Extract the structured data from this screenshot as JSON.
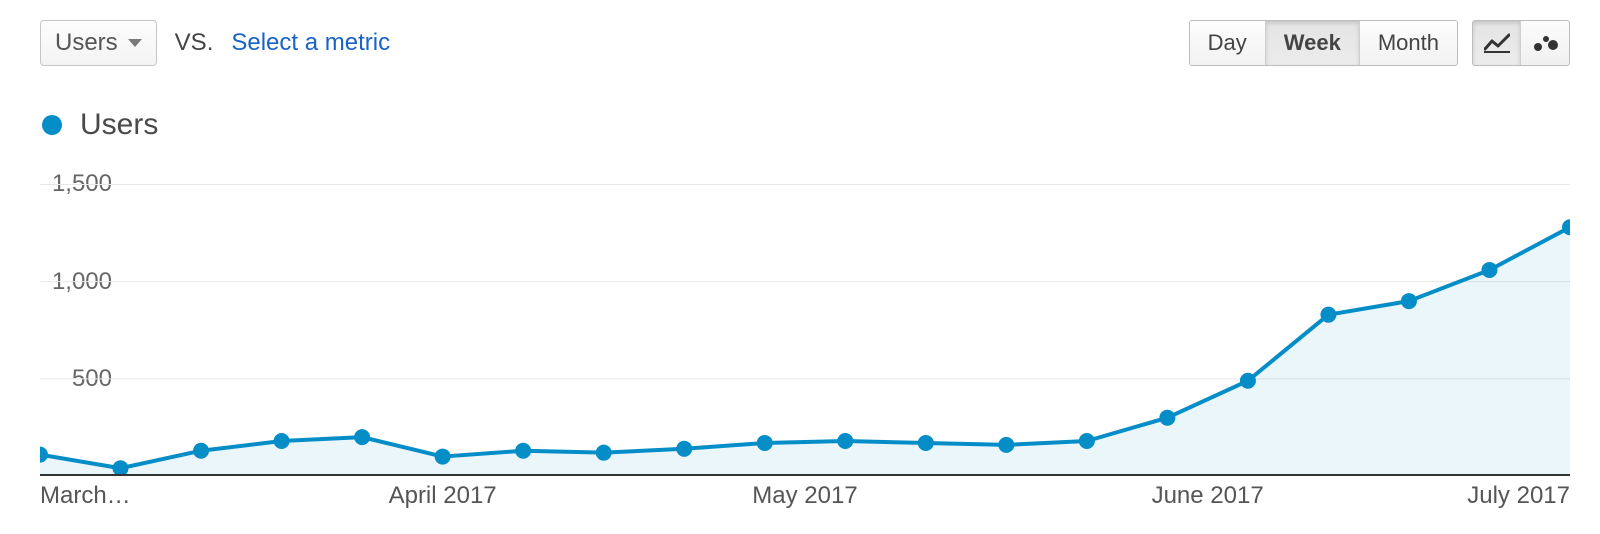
{
  "toolbar": {
    "primary_metric": "Users",
    "vs_label": "VS.",
    "select_metric_label": "Select a metric",
    "granularity": {
      "options": [
        "Day",
        "Week",
        "Month"
      ],
      "active_index": 1
    },
    "chart_type_icons": [
      "line-chart-icon",
      "motion-chart-icon"
    ],
    "chart_type_active_index": 0
  },
  "legend": {
    "series_label": "Users",
    "series_color": "#058dc7"
  },
  "y_ticks": [
    "1,500",
    "1,000",
    "500"
  ],
  "x_major_ticks": [
    "March…",
    "April 2017",
    "May 2017",
    "June 2017",
    "July 2017"
  ],
  "chart_data": {
    "type": "line",
    "title": "",
    "xlabel": "",
    "ylabel": "",
    "ylim": [
      0,
      1600
    ],
    "x_range_labels": [
      "March 2017",
      "April 2017",
      "May 2017",
      "June 2017",
      "July 2017"
    ],
    "series": [
      {
        "name": "Users",
        "color": "#058dc7",
        "x": [
          0,
          1,
          2,
          3,
          4,
          5,
          6,
          7,
          8,
          9,
          10,
          11,
          12,
          13,
          14,
          15,
          16,
          17,
          18,
          19
        ],
        "values": [
          110,
          40,
          130,
          180,
          200,
          100,
          130,
          120,
          140,
          170,
          180,
          170,
          160,
          180,
          300,
          490,
          830,
          900,
          1060,
          1280
        ]
      }
    ],
    "x_major_tick_positions": [
      0,
      5,
      9.5,
      14.5,
      19
    ],
    "x_major_tick_labels": [
      "March…",
      "April 2017",
      "May 2017",
      "June 2017",
      "July 2017"
    ]
  }
}
